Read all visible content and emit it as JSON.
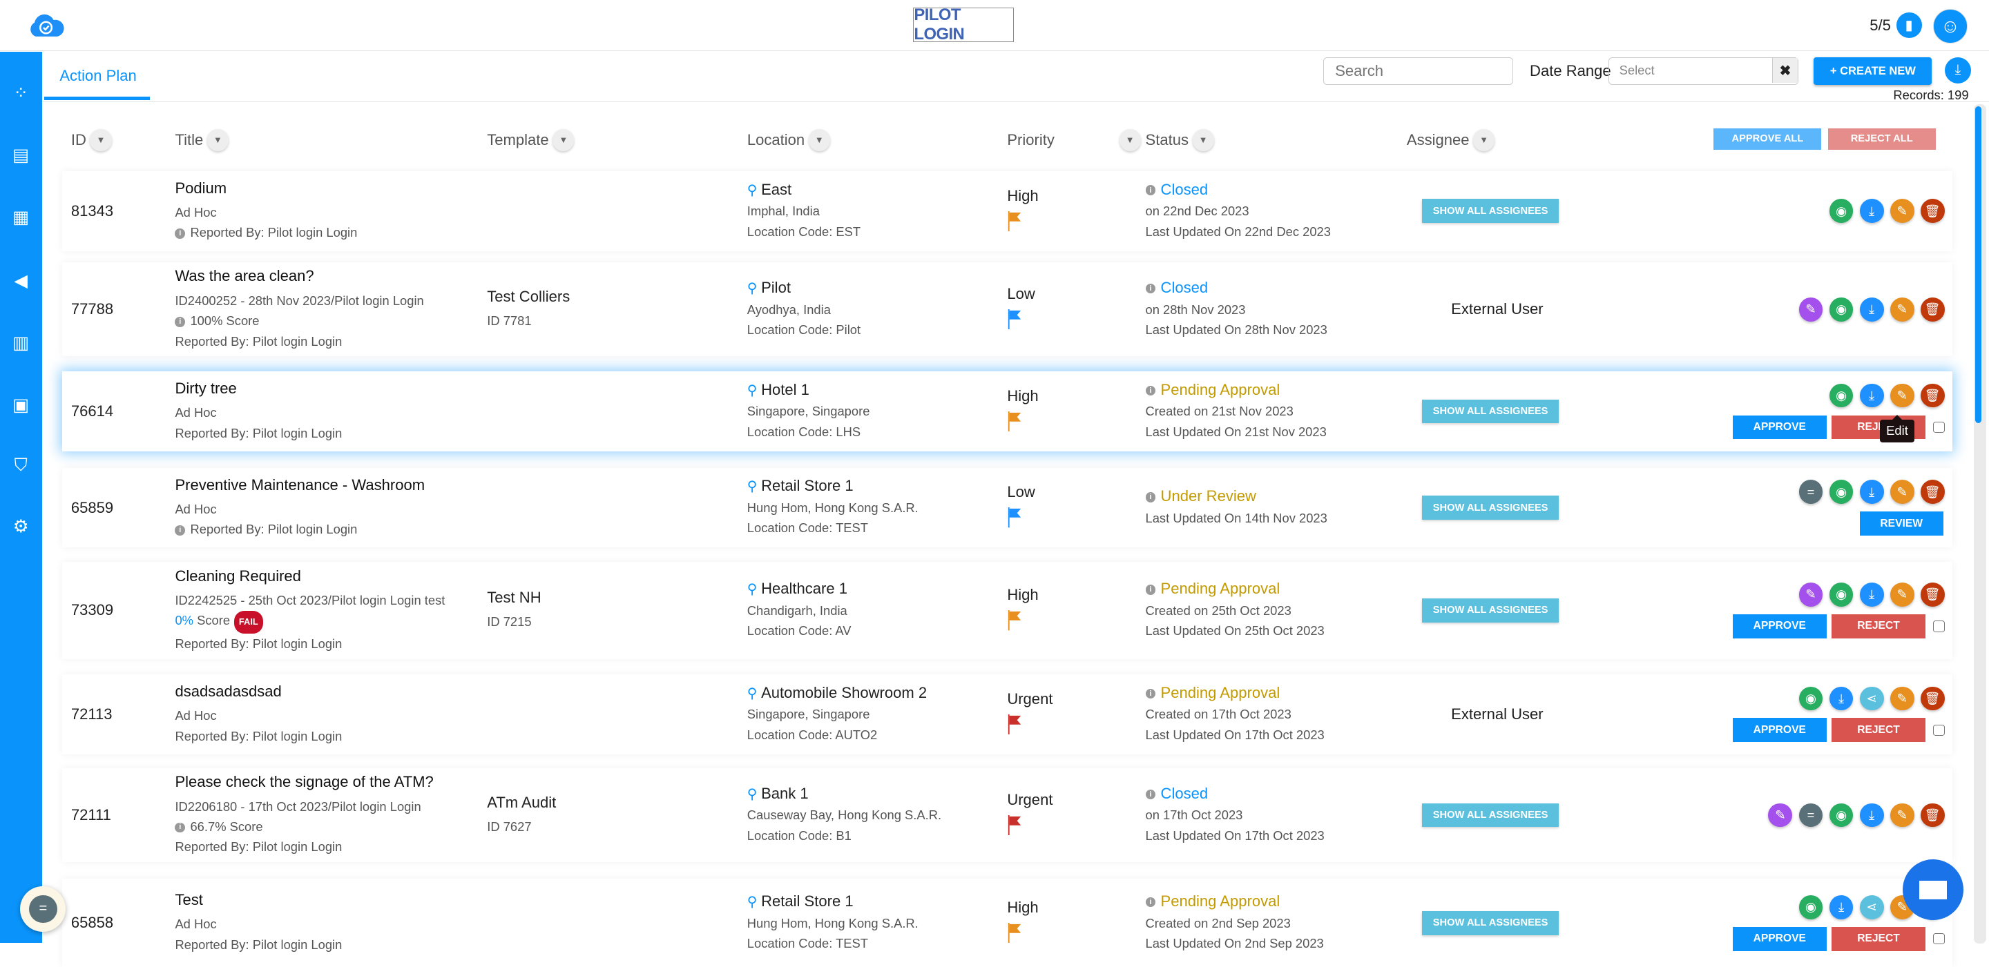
{
  "header": {
    "brand": "PILOT LOGIN",
    "count": "5/5"
  },
  "sidebar": {
    "items": [
      "dashboard-icon",
      "clipboard-icon",
      "document-icon",
      "megaphone-icon",
      "analytics-icon",
      "training-icon",
      "shield-icon",
      "gear-icon"
    ]
  },
  "tabs": [
    {
      "label": "Action Plan",
      "active": true
    }
  ],
  "toolbar": {
    "search_placeholder": "Search",
    "date_range_label": "Date Range",
    "date_range_placeholder": "Select",
    "clear": "✖",
    "create_new": "+ CREATE NEW",
    "records": "Records: 199"
  },
  "columns": {
    "id": "ID",
    "title": "Title",
    "template": "Template",
    "location": "Location",
    "priority": "Priority",
    "status": "Status",
    "assignee": "Assignee",
    "approve_all": "APPROVE ALL",
    "reject_all": "REJECT ALL"
  },
  "labels": {
    "show_all": "SHOW ALL ASSIGNEES",
    "approve": "APPROVE",
    "reject": "REJECT",
    "review": "REVIEW",
    "fail": "FAIL",
    "tooltip": "Edit"
  },
  "colors": {
    "accent": "#0a94fb",
    "closed": "#0a94fb",
    "pending": "#c39b00",
    "high": "#e8901f",
    "low": "#1e90ff",
    "urgent": "#c9302c"
  },
  "rows": [
    {
      "id": "81343",
      "title": "Podium",
      "lines": [
        {
          "text": "Ad Hoc"
        },
        {
          "text": "Reported By: Pilot login Login",
          "info": true
        }
      ],
      "template": null,
      "location": {
        "name": "East",
        "city": "Imphal, India",
        "code": "Location Code: EST"
      },
      "priority": "High",
      "status": {
        "label": "Closed",
        "kind": "closed",
        "lines": [
          "on 22nd Dec 2023",
          "Last Updated On 22nd Dec 2023"
        ]
      },
      "assignee": "button",
      "actions": [
        "view",
        "download",
        "edit",
        "delete"
      ],
      "buttons": null
    },
    {
      "id": "77788",
      "title": "Was the area clean?",
      "lines": [
        {
          "text": "ID2400252 - 28th Nov 2023/Pilot login Login"
        },
        {
          "text": "100% Score",
          "info": true
        },
        {
          "text": "Reported By: Pilot login Login"
        }
      ],
      "template": {
        "name": "Test Colliers",
        "id": "ID 7781"
      },
      "location": {
        "name": "Pilot",
        "city": "Ayodhya, India",
        "code": "Location Code: Pilot"
      },
      "priority": "Low",
      "status": {
        "label": "Closed",
        "kind": "closed",
        "lines": [
          "on 28th Nov 2023",
          "Last Updated On 28th Nov 2023"
        ]
      },
      "assignee": "External User",
      "actions": [
        "edit-purple",
        "view",
        "download",
        "edit",
        "delete"
      ],
      "buttons": null
    },
    {
      "id": "76614",
      "title": "Dirty tree",
      "lines": [
        {
          "text": "Ad Hoc"
        },
        {
          "text": "Reported By: Pilot login Login"
        }
      ],
      "template": null,
      "location": {
        "name": "Hotel 1",
        "city": "Singapore, Singapore",
        "code": "Location Code: LHS"
      },
      "priority": "High",
      "status": {
        "label": "Pending Approval",
        "kind": "pending",
        "lines": [
          "Created on 21st Nov 2023",
          "Last Updated On 21st Nov 2023"
        ]
      },
      "assignee": "button",
      "actions": [
        "view",
        "download",
        "edit",
        "delete"
      ],
      "buttons": "approve",
      "highlight": true
    },
    {
      "id": "65859",
      "title": "Preventive Maintenance - Washroom",
      "lines": [
        {
          "text": "Ad Hoc"
        },
        {
          "text": "Reported By: Pilot login Login",
          "info": true
        }
      ],
      "template": null,
      "location": {
        "name": "Retail Store 1",
        "city": "Hung Hom, Hong Kong S.A.R.",
        "code": "Location Code: TEST"
      },
      "priority": "Low",
      "status": {
        "label": "Under Review",
        "kind": "pending",
        "lines": [
          "Last Updated On 14th Nov 2023"
        ]
      },
      "assignee": "button",
      "actions": [
        "comment",
        "view",
        "download",
        "edit",
        "delete"
      ],
      "buttons": "review"
    },
    {
      "id": "73309",
      "title": "Cleaning Required",
      "lines": [
        {
          "text": "ID2242525 - 25th Oct 2023/Pilot login Login test"
        },
        {
          "score": "0%",
          "text": "Score",
          "fail": true
        },
        {
          "text": "Reported By: Pilot login Login"
        }
      ],
      "template": {
        "name": "Test NH",
        "id": "ID 7215"
      },
      "location": {
        "name": "Healthcare 1",
        "city": "Chandigarh, India",
        "code": "Location Code: AV"
      },
      "priority": "High",
      "status": {
        "label": "Pending Approval",
        "kind": "pending",
        "lines": [
          "Created on 25th Oct 2023",
          "Last Updated On 25th Oct 2023"
        ]
      },
      "assignee": "button",
      "actions": [
        "edit-purple",
        "view",
        "download",
        "edit",
        "delete"
      ],
      "buttons": "approve"
    },
    {
      "id": "72113",
      "title": "dsadsadasdsad",
      "lines": [
        {
          "text": "Ad Hoc"
        },
        {
          "text": "Reported By: Pilot login Login"
        }
      ],
      "template": null,
      "location": {
        "name": "Automobile Showroom 2",
        "city": "Singapore, Singapore",
        "code": "Location Code: AUTO2"
      },
      "priority": "Urgent",
      "status": {
        "label": "Pending Approval",
        "kind": "pending",
        "lines": [
          "Created on 17th Oct 2023",
          "Last Updated On 17th Oct 2023"
        ]
      },
      "assignee": "External User",
      "actions": [
        "view",
        "download",
        "share",
        "edit",
        "delete"
      ],
      "buttons": "approve"
    },
    {
      "id": "72111",
      "title": "Please check the signage of the ATM?",
      "lines": [
        {
          "text": "ID2206180 - 17th Oct 2023/Pilot login Login"
        },
        {
          "text": "66.7% Score",
          "info": true
        },
        {
          "text": "Reported By: Pilot login Login"
        }
      ],
      "template": {
        "name": "ATm Audit",
        "id": "ID 7627"
      },
      "location": {
        "name": "Bank 1",
        "city": "Causeway Bay, Hong Kong S.A.R.",
        "code": "Location Code: B1"
      },
      "priority": "Urgent",
      "status": {
        "label": "Closed",
        "kind": "closed",
        "lines": [
          "on 17th Oct 2023",
          "Last Updated On 17th Oct 2023"
        ]
      },
      "assignee": "button",
      "actions": [
        "edit-purple",
        "comment",
        "view",
        "download",
        "edit",
        "delete"
      ],
      "buttons": null
    },
    {
      "id": "65858",
      "title": "Test",
      "lines": [
        {
          "text": "Ad Hoc"
        },
        {
          "text": "Reported By: Pilot login Login"
        }
      ],
      "template": null,
      "location": {
        "name": "Retail Store 1",
        "city": "Hung Hom, Hong Kong S.A.R.",
        "code": "Location Code: TEST"
      },
      "priority": "High",
      "status": {
        "label": "Pending Approval",
        "kind": "pending",
        "lines": [
          "Created on 2nd Sep 2023",
          "Last Updated On 2nd Sep 2023"
        ]
      },
      "assignee": "button",
      "actions": [
        "view",
        "download",
        "share",
        "edit",
        "delete"
      ],
      "buttons": "approve"
    }
  ]
}
